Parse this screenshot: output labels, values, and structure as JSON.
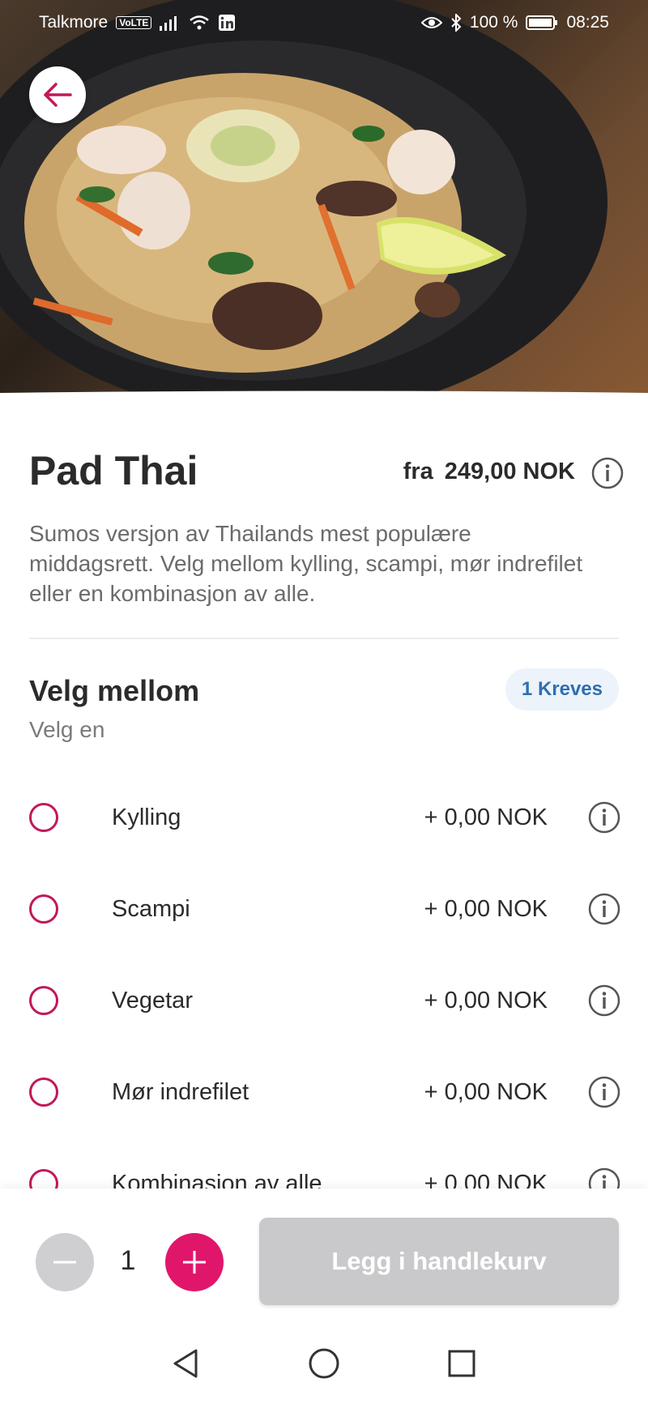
{
  "status_bar": {
    "carrier": "Talkmore",
    "volte": "VoLTE",
    "battery": "100 %",
    "time": "08:25"
  },
  "product": {
    "title": "Pad Thai",
    "price_prefix": "fra",
    "price": "249,00 NOK",
    "description": "Sumos versjon av Thailands mest populære middagsrett. Velg mellom kylling, scampi, mør indrefilet eller en kombinasjon av alle."
  },
  "option_group": {
    "title": "Velg mellom",
    "subtitle": "Velg en",
    "badge": "1 Kreves",
    "options": [
      {
        "label": "Kylling",
        "price": "+ 0,00 NOK"
      },
      {
        "label": "Scampi",
        "price": "+ 0,00 NOK"
      },
      {
        "label": "Vegetar",
        "price": "+ 0,00 NOK"
      },
      {
        "label": "Mør indrefilet",
        "price": "+ 0,00 NOK"
      },
      {
        "label": "Kombinasjon av alle",
        "price": "+ 0,00 NOK"
      }
    ]
  },
  "cart": {
    "quantity": "1",
    "add_label": "Legg i handlekurv"
  },
  "colors": {
    "accent": "#e0166b",
    "radio_border": "#c2185b",
    "badge_bg": "#edf3fb",
    "badge_text": "#2e6fb0",
    "disabled_button": "#c9c9cb"
  },
  "icons": [
    "back-arrow-icon",
    "info-icon",
    "minus-icon",
    "plus-icon",
    "nav-back-icon",
    "nav-home-icon",
    "nav-recents-icon"
  ]
}
